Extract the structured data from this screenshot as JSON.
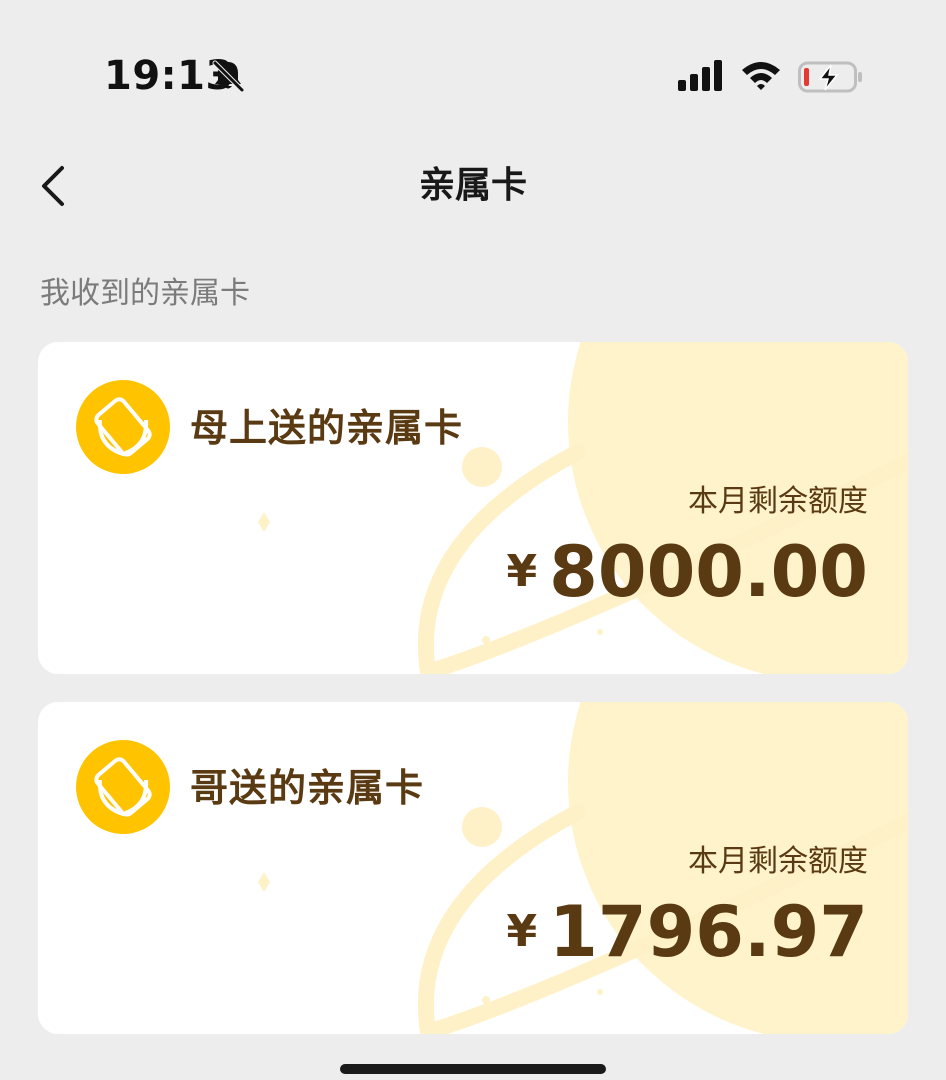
{
  "status_bar": {
    "time": "19:13",
    "icons": [
      "bell-slash-icon",
      "cellular-signal-icon",
      "wifi-icon",
      "battery-charging-icon"
    ]
  },
  "nav": {
    "back_icon": "chevron-left-icon",
    "title": "亲属卡"
  },
  "section": {
    "label": "我收到的亲属卡"
  },
  "cards": [
    {
      "name": "母上送的亲属卡",
      "quota_label": "本月剩余额度",
      "currency": "¥",
      "amount": "8000.00"
    },
    {
      "name": "哥送的亲属卡",
      "quota_label": "本月剩余额度",
      "currency": "¥",
      "amount": "1796.97"
    }
  ],
  "colors": {
    "page_bg": "#EDEDED",
    "card_bg": "#FFFFFF",
    "accent_yellow": "#FFC300",
    "card_deco": "#FFF1C7",
    "text_brown": "#5A3A12",
    "battery_low": "#E53935"
  }
}
